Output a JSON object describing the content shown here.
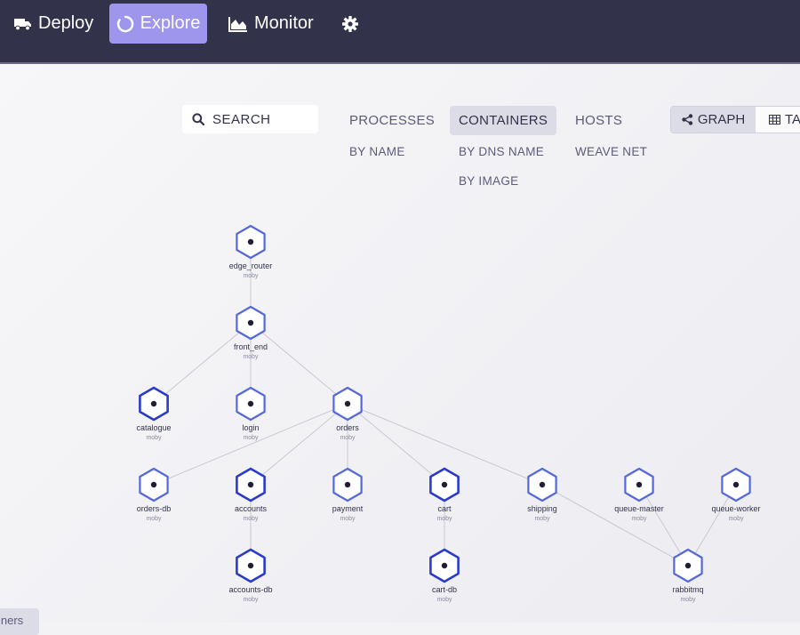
{
  "nav": {
    "deploy": "Deploy",
    "explore": "Explore",
    "monitor": "Monitor"
  },
  "search": {
    "placeholder": "SEARCH"
  },
  "topologies": {
    "processes": "PROCESSES",
    "processes_by_name": "BY NAME",
    "containers": "CONTAINERS",
    "containers_by_dns": "BY DNS NAME",
    "containers_by_image": "BY IMAGE",
    "hosts": "HOSTS",
    "weave_net": "WEAVE NET"
  },
  "view_mode": {
    "graph": "GRAPH",
    "table": "TA"
  },
  "graph": {
    "nodes": [
      {
        "id": "edge_router",
        "label": "edge_router",
        "sub": "moby"
      },
      {
        "id": "front_end",
        "label": "front_end",
        "sub": "moby"
      },
      {
        "id": "catalogue",
        "label": "catalogue",
        "sub": "moby"
      },
      {
        "id": "login",
        "label": "login",
        "sub": "moby"
      },
      {
        "id": "orders",
        "label": "orders",
        "sub": "moby"
      },
      {
        "id": "orders-db",
        "label": "orders-db",
        "sub": "moby"
      },
      {
        "id": "accounts",
        "label": "accounts",
        "sub": "moby"
      },
      {
        "id": "payment",
        "label": "payment",
        "sub": "moby"
      },
      {
        "id": "cart",
        "label": "cart",
        "sub": "moby"
      },
      {
        "id": "shipping",
        "label": "shipping",
        "sub": "moby"
      },
      {
        "id": "queue-master",
        "label": "queue-master",
        "sub": "moby"
      },
      {
        "id": "queue-worker",
        "label": "queue-worker",
        "sub": "moby"
      },
      {
        "id": "accounts-db",
        "label": "accounts-db",
        "sub": "moby"
      },
      {
        "id": "cart-db",
        "label": "cart-db",
        "sub": "moby"
      },
      {
        "id": "rabbitmq",
        "label": "rabbitmq",
        "sub": "moby"
      }
    ],
    "edges": [
      [
        "edge_router",
        "front_end"
      ],
      [
        "front_end",
        "catalogue"
      ],
      [
        "front_end",
        "login"
      ],
      [
        "front_end",
        "orders"
      ],
      [
        "orders",
        "orders-db"
      ],
      [
        "orders",
        "accounts"
      ],
      [
        "orders",
        "payment"
      ],
      [
        "orders",
        "cart"
      ],
      [
        "orders",
        "shipping"
      ],
      [
        "accounts",
        "accounts-db"
      ],
      [
        "cart",
        "cart-db"
      ],
      [
        "shipping",
        "rabbitmq"
      ],
      [
        "queue-master",
        "rabbitmq"
      ],
      [
        "queue-worker",
        "rabbitmq"
      ]
    ]
  },
  "bottom_tab": "iners",
  "colors": {
    "nav_bg": "#32324b",
    "nav_active": "#9e96ec",
    "node_stroke": "#3f51d8",
    "edge": "#c8c8d4"
  }
}
